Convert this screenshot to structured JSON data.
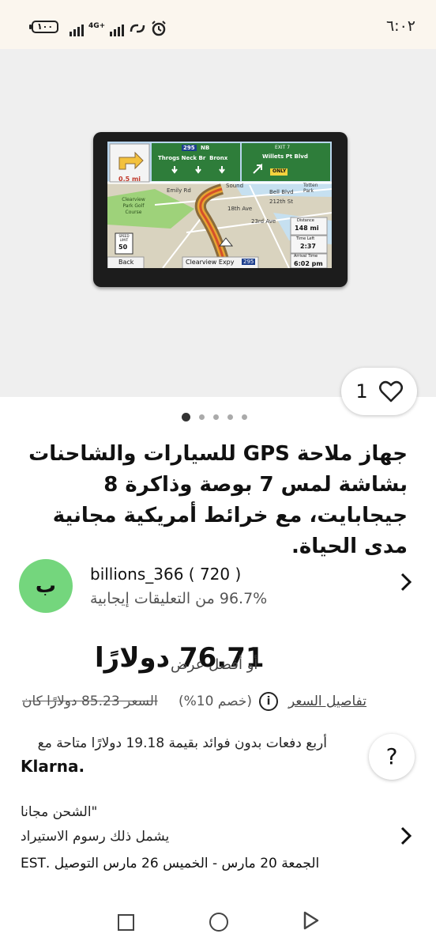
{
  "status_bar": {
    "time": "٦:٠٢",
    "battery": "١٠٠",
    "network": "4G+"
  },
  "product_image": {
    "gps": {
      "turn_distance": "0.5 mi",
      "sign1_route": "295",
      "sign1_dir": "NB",
      "sign1_text": "Throgs Neck Br  Bronx",
      "sign2_exit": "EXIT 7",
      "sign2_text": "Willets Pt Blvd",
      "sign2_only": "ONLY",
      "streets": [
        "Emily Rd",
        "Sound",
        "Bell Blvd",
        "212th St",
        "Totten Park",
        "18th Ave",
        "23rd Ave",
        "Clearview Park Golf Course"
      ],
      "speed_limit_label": "SPEED LIMIT",
      "speed_limit": "50",
      "distance_label": "Distance",
      "distance_value": "148 mi",
      "time_left_label": "Time Left",
      "time_left_value": "2:37",
      "arrival_label": "Arrival Time",
      "arrival_value": "6:02 pm",
      "back_label": "Back",
      "road_label": "Clearview Expy",
      "road_shield": "295"
    }
  },
  "like_count": "1",
  "image_dots": {
    "count": 5,
    "active": 0
  },
  "title": "جهاز ملاحة GPS للسيارات والشاحنات بشاشة لمس 7 بوصة وذاكرة 8 جيجابايت، مع خرائط أمريكية مجانية مدى الحياة.",
  "seller": {
    "avatar_letter": "ب",
    "name": "billions_366 ( 720 )",
    "rating": "96.7% من التعليقات إيجابية"
  },
  "price": {
    "value": "76.71 دولارًا",
    "best_offer": "أو أفضل عرض",
    "details_link": "تفاصيل السعر",
    "discount": "(خصم 10%)",
    "was": "السعر 85.23 دولارًا كان"
  },
  "klarna": {
    "text": "أربع دفعات بدون فوائد بقيمة 19.18 دولارًا متاحة مع",
    "logo": "Klarna."
  },
  "help_label": "?",
  "shipping": {
    "line1": "\"الشحن مجانا",
    "line2": "يشمل ذلك رسوم الاستيراد",
    "line3": "الجمعة 20 مارس - الخميس 26 مارس التوصيل .EST"
  },
  "colors": {
    "avatar_green": "#74d67d",
    "hero_bg": "#efefef",
    "statusbar_bg": "#fbf6ee"
  }
}
